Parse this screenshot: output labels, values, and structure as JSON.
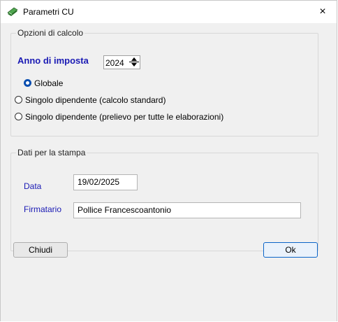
{
  "window": {
    "title": "Parametri CU",
    "close_glyph": "×"
  },
  "group_calcolo": {
    "legend": "Opzioni di calcolo",
    "anno_label": "Anno di imposta",
    "anno_value": "2024",
    "radios": [
      {
        "label": "Globale",
        "checked": true
      },
      {
        "label": "Singolo dipendente (calcolo standard)",
        "checked": false
      },
      {
        "label": "Singolo dipendente (prelievo per tutte le elaborazioni)",
        "checked": false
      }
    ]
  },
  "group_stampa": {
    "legend": "Dati per la stampa",
    "data_label": "Data",
    "data_value": "19/02/2025",
    "firmatario_label": "Firmatario",
    "firmatario_value": "Pollice Francescoantonio"
  },
  "buttons": {
    "close": "Chiudi",
    "ok": "Ok"
  },
  "colors": {
    "label_blue": "#1a1ab4",
    "radio_checked": "#0b4fb0",
    "icon_green": "#2f7a2f"
  }
}
